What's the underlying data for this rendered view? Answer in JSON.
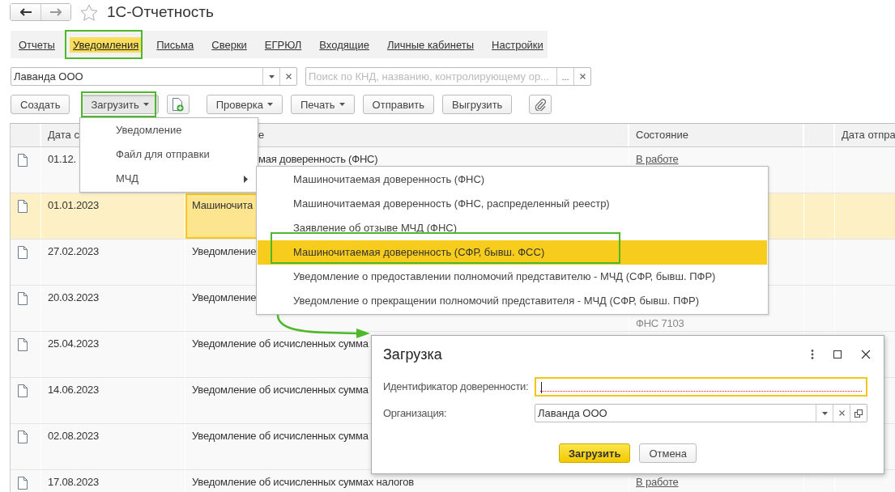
{
  "window": {
    "title": "1С-Отчетность"
  },
  "tabs": [
    {
      "label": "Отчеты",
      "selected": false
    },
    {
      "label": "Уведомления",
      "selected": true
    },
    {
      "label": "Письма",
      "selected": false
    },
    {
      "label": "Сверки",
      "selected": false
    },
    {
      "label": "ЕГРЮЛ",
      "selected": false
    },
    {
      "label": "Входящие",
      "selected": false
    },
    {
      "label": "Личные кабинеты",
      "selected": false
    },
    {
      "label": "Настройки",
      "selected": false
    }
  ],
  "filter": {
    "organization": "Лаванда ООО",
    "search_placeholder": "Поиск по КНД, названию, контролирующему ор...",
    "more_button": "..."
  },
  "toolbar": [
    {
      "kind": "button",
      "label": "Создать"
    },
    {
      "kind": "menu",
      "label": "Загрузить",
      "pressed": true
    },
    {
      "kind": "add_doc"
    },
    {
      "kind": "menu",
      "label": "Проверка",
      "pressed": false
    },
    {
      "kind": "menu",
      "label": "Печать",
      "pressed": false
    },
    {
      "kind": "button",
      "label": "Отправить"
    },
    {
      "kind": "button",
      "label": "Выгрузить"
    },
    {
      "kind": "attach"
    }
  ],
  "table": {
    "columns": {
      "date": "Дата с",
      "name": "е",
      "status": "Состояние",
      "sent_date": "Дата отпра"
    },
    "rows": [
      {
        "date": "01.12.",
        "name": "мая доверенность (ФНС)",
        "status": "В работе",
        "selected": false
      },
      {
        "date": "01.01.2023",
        "name": "Машиночита",
        "selected": true
      },
      {
        "date": "27.02.2023",
        "name": "Уведомление",
        "selected": false
      },
      {
        "date": "20.03.2023",
        "name": "Уведомление",
        "authority": "ФНС 7103",
        "selected": false
      },
      {
        "date": "25.04.2023",
        "name": "Уведомление об исчисленных сумма",
        "selected": false
      },
      {
        "date": "14.06.2023",
        "name": "Уведомление об исчисленных сумма",
        "selected": false
      },
      {
        "date": "02.08.2023",
        "name": "Уведомление об исчисленных сумма",
        "selected": false
      },
      {
        "date": "17.08.2023",
        "name": "Уведомление об исчисленных суммах налогов",
        "status": "В работе",
        "selected": false
      }
    ]
  },
  "menu": {
    "items": [
      {
        "kind": "item",
        "label": "Уведомление"
      },
      {
        "kind": "item",
        "label": "Файл для отправки"
      },
      {
        "kind": "submenu",
        "label": "МЧД"
      }
    ]
  },
  "submenu": {
    "items": [
      {
        "label": "Машиночитаемая доверенность (ФНС)",
        "selected": false
      },
      {
        "label": "Машиночитаемая доверенность (ФНС, распределенный реестр)",
        "selected": false
      },
      {
        "label": "Заявление об отзыве МЧД (ФНС)",
        "selected": false
      },
      {
        "label": "Машиночитаемая доверенность (СФР, бывш. ФСС)",
        "selected": true
      },
      {
        "label": "Уведомление о предоставлении полномочий представителю - МЧД (СФР, бывш. ПФР)",
        "selected": false
      },
      {
        "label": "Уведомление о прекращении полномочий представителя - МЧД (СФР, бывш. ПФР)",
        "selected": false
      }
    ]
  },
  "dialog": {
    "title": "Загрузка",
    "fields": [
      {
        "kind": "text",
        "label": "Идентификатор доверенности:",
        "focused": true,
        "required": true
      },
      {
        "kind": "combo",
        "label": "Организация:",
        "value": "Лаванда ООО"
      }
    ],
    "buttons": [
      {
        "label": "Загрузить",
        "default": true
      },
      {
        "label": "Отмена",
        "default": false
      }
    ]
  }
}
